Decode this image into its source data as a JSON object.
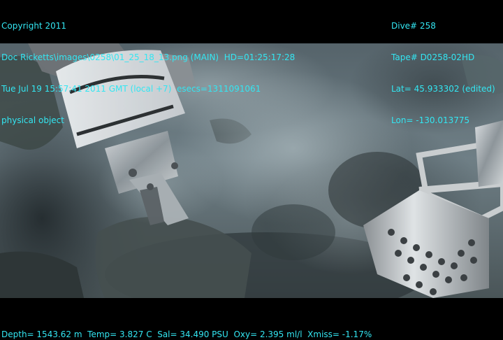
{
  "overlay": {
    "top_left": [
      "Copyright 2011",
      "Doc Ricketts\\images\\0258\\01_25_18_13.png (MAIN)  HD=01:25:17:28",
      "Tue Jul 19 15:57:41 2011 GMT (local +7)  esecs=1311091061",
      "physical object"
    ],
    "top_right": [
      "Dive# 258",
      "Tape# D0258-02HD",
      "Lat= 45.933302 (edited)",
      "Lon= -130.013775"
    ],
    "bottom": "Depth= 1543.62 m  Temp= 3.827 C  Sal= 34.490 PSU  Oxy= 2.395 ml/l  Xmiss= -1.17%",
    "text_color": "#33e6f2"
  }
}
